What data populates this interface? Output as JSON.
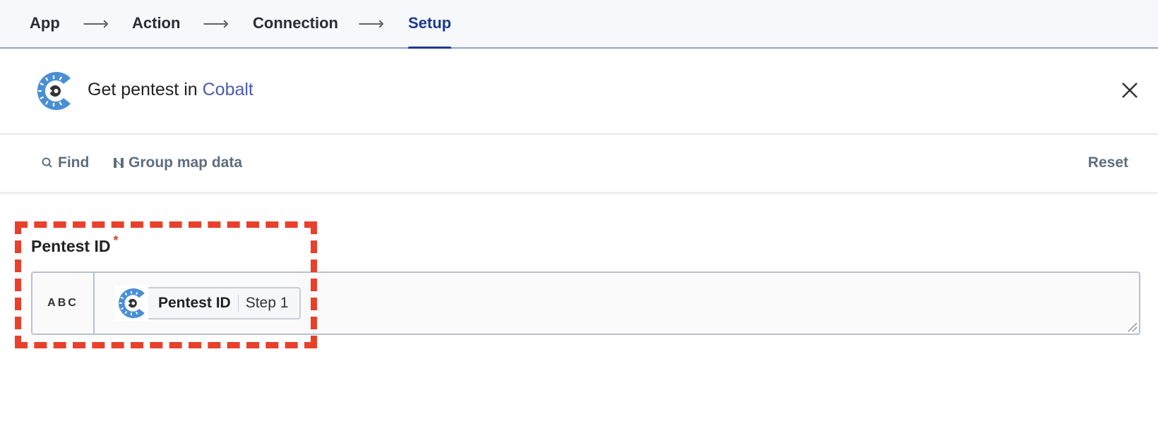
{
  "stepper": {
    "steps": [
      {
        "label": "App",
        "active": false
      },
      {
        "label": "Action",
        "active": false
      },
      {
        "label": "Connection",
        "active": false
      },
      {
        "label": "Setup",
        "active": true
      }
    ],
    "arrow_glyph": "⟶"
  },
  "header": {
    "title_prefix": "Get pentest in ",
    "app_name": "Cobalt",
    "app_icon": "cobalt-logo",
    "close_icon": "close-icon"
  },
  "toolbar": {
    "find_label": "Find",
    "find_icon": "search-icon",
    "group_label": "Group map data",
    "group_icon": "group-map-icon",
    "reset_label": "Reset"
  },
  "field": {
    "label": "Pentest ID",
    "required_marker": "*",
    "type_badge": "ABC",
    "mapped_value": {
      "app_icon": "cobalt-logo",
      "name": "Pentest ID",
      "step": "Step 1"
    }
  },
  "colors": {
    "active_step": "#1d3a8f",
    "app_link": "#4a5cae",
    "cobalt_blue": "#4a8fd4",
    "highlight": "#e8402a",
    "required": "#d4432a"
  }
}
